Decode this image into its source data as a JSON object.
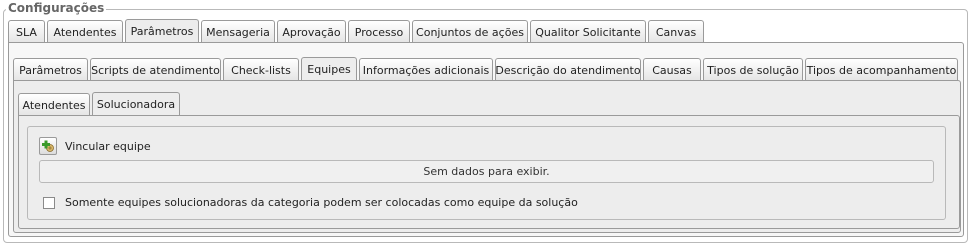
{
  "fieldset": {
    "legend": "Configurações"
  },
  "tabs_main": [
    {
      "label": "SLA",
      "active": false
    },
    {
      "label": "Atendentes",
      "active": false
    },
    {
      "label": "Parâmetros",
      "active": true
    },
    {
      "label": "Mensageria",
      "active": false
    },
    {
      "label": "Aprovação",
      "active": false
    },
    {
      "label": "Processo",
      "active": false
    },
    {
      "label": "Conjuntos de ações",
      "active": false
    },
    {
      "label": "Qualitor Solicitante",
      "active": false
    },
    {
      "label": "Canvas",
      "active": false
    }
  ],
  "tabs_params": [
    {
      "label": "Parâmetros",
      "active": false
    },
    {
      "label": "Scripts de atendimento",
      "active": false
    },
    {
      "label": "Check-lists",
      "active": false
    },
    {
      "label": "Equipes",
      "active": true
    },
    {
      "label": "Informações adicionais",
      "active": false
    },
    {
      "label": "Descrição do atendimento",
      "active": false
    },
    {
      "label": "Causas",
      "active": false
    },
    {
      "label": "Tipos de solução",
      "active": false
    },
    {
      "label": "Tipos de acompanhamento",
      "active": false
    }
  ],
  "tabs_equipes": [
    {
      "label": "Atendentes",
      "active": false
    },
    {
      "label": "Solucionadora",
      "active": true
    }
  ],
  "content": {
    "link_equipe_label": "Vincular equipe",
    "link_equipe_icon": "add-team-icon",
    "empty_message": "Sem dados para exibir.",
    "checkbox_label": "Somente equipes solucionadoras da categoria podem ser colocadas como equipe da solução",
    "checkbox_checked": false
  },
  "colors": {
    "panel_bg": "#ededed",
    "border": "#9a9a9a",
    "icon_green": "#3a9a2a"
  }
}
